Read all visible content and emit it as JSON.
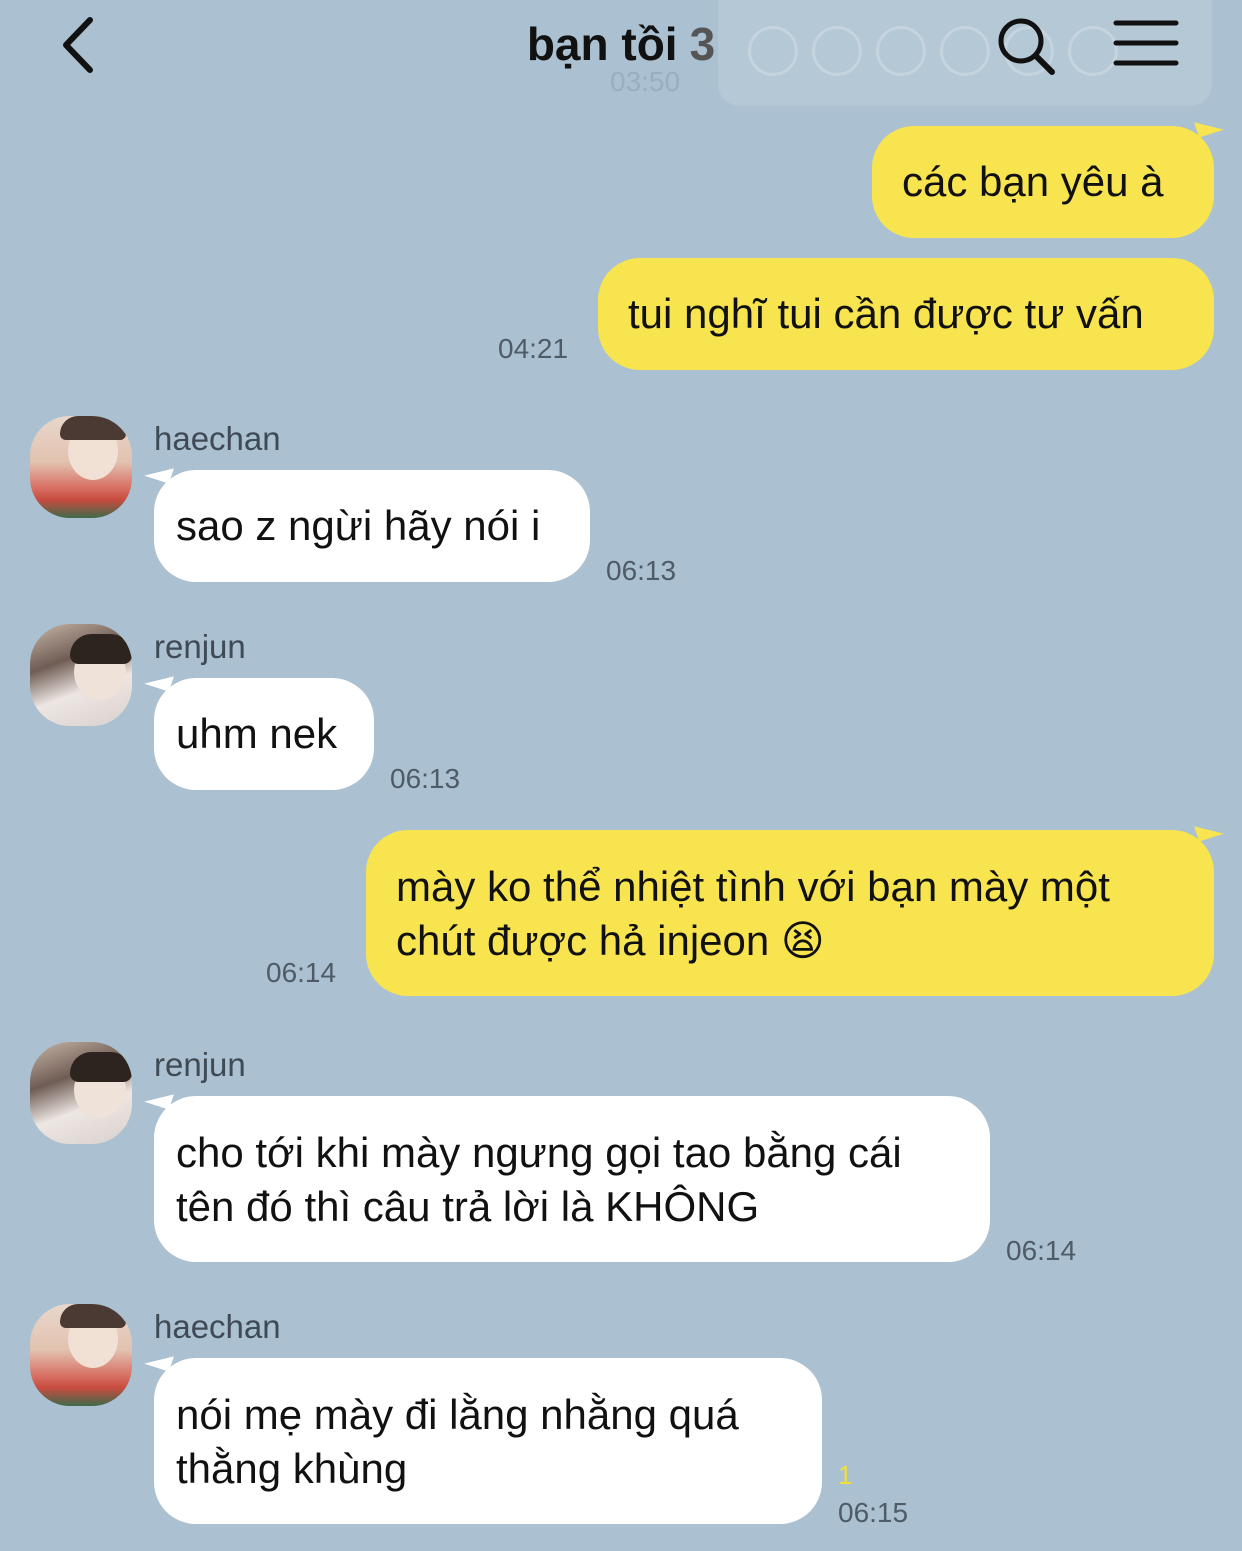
{
  "header": {
    "title": "bạn tồi",
    "member_count": "3",
    "ghost_time": "03:50"
  },
  "messages": [
    {
      "id": "m1",
      "side": "me",
      "text": "các bạn yêu à"
    },
    {
      "id": "m2",
      "side": "me",
      "text": "tui nghĩ tui cần được tư vấn",
      "time": "04:21"
    },
    {
      "id": "m3",
      "side": "them",
      "sender": "haechan",
      "text": "sao z ngừi hãy nói i",
      "time": "06:13"
    },
    {
      "id": "m4",
      "side": "them",
      "sender": "renjun",
      "text": "uhm nek",
      "time": "06:13"
    },
    {
      "id": "m5",
      "side": "me",
      "lines": [
        "mày ko thể nhiệt tình với bạn mày một",
        "chút được hả injeon 😫"
      ],
      "time": "06:14"
    },
    {
      "id": "m6",
      "side": "them",
      "sender": "renjun",
      "lines": [
        "cho tới khi mày ngưng gọi tao bằng cái",
        "tên đó thì câu trả lời là KHÔNG"
      ],
      "time": "06:14"
    },
    {
      "id": "m7",
      "side": "them",
      "sender": "haechan",
      "lines": [
        "nói mẹ mày đi lằng nhằng quá",
        "thằng khùng"
      ],
      "time": "06:15",
      "unread_count": "1"
    }
  ],
  "icons": {
    "back": "chevron-left-icon",
    "search": "search-icon",
    "menu": "menu-icon"
  },
  "colors": {
    "background": "#abc1d1",
    "my_bubble": "#f7e44f",
    "their_bubble": "#ffffff",
    "unread": "#f2df39"
  }
}
